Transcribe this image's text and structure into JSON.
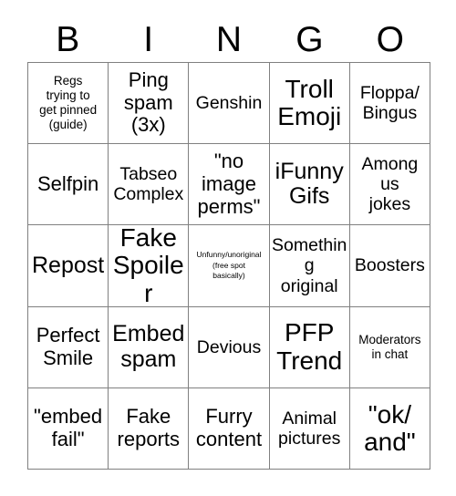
{
  "header": {
    "letters": [
      "B",
      "I",
      "N",
      "G",
      "O"
    ]
  },
  "grid": {
    "rows": 5,
    "columns": 5,
    "border_color": "#808080",
    "background_color": "#ffffff",
    "text_color": "#000000",
    "cells": [
      {
        "text": "Regs\ntrying to\nget pinned\n(guide)",
        "size": "xs",
        "free_space": false
      },
      {
        "text": "Ping\nspam\n(3x)",
        "size": "lg",
        "free_space": false
      },
      {
        "text": "Genshin",
        "size": "md",
        "free_space": false
      },
      {
        "text": "Troll\nEmoji",
        "size": "xxl",
        "free_space": false
      },
      {
        "text": "Floppa/\nBingus",
        "size": "md",
        "free_space": false
      },
      {
        "text": "Selfpin",
        "size": "lg",
        "free_space": false
      },
      {
        "text": "Tabseo\nComplex",
        "size": "md",
        "free_space": false
      },
      {
        "text": "\"no\nimage\nperms\"",
        "size": "lg",
        "free_space": false
      },
      {
        "text": "iFunny\nGifs",
        "size": "xl",
        "free_space": false
      },
      {
        "text": "Among\nus\njokes",
        "size": "md",
        "free_space": false
      },
      {
        "text": "Repost",
        "size": "xl",
        "free_space": false
      },
      {
        "text": "Fake\nSpoiler",
        "size": "xxl",
        "free_space": false
      },
      {
        "text": "Unfunny/unoriginal\n(free spot\nbasically)",
        "size": "xxs",
        "free_space": true
      },
      {
        "text": "Something\noriginal",
        "size": "md",
        "free_space": false
      },
      {
        "text": "Boosters",
        "size": "md",
        "free_space": false
      },
      {
        "text": "Perfect\nSmile",
        "size": "lg",
        "free_space": false
      },
      {
        "text": "Embed\nspam",
        "size": "xl",
        "free_space": false
      },
      {
        "text": "Devious",
        "size": "md",
        "free_space": false
      },
      {
        "text": "PFP\nTrend",
        "size": "xxl",
        "free_space": false
      },
      {
        "text": "Moderators\nin chat",
        "size": "xs",
        "free_space": false
      },
      {
        "text": "\"embed\nfail\"",
        "size": "lg",
        "free_space": false
      },
      {
        "text": "Fake\nreports",
        "size": "lg",
        "free_space": false
      },
      {
        "text": "Furry\ncontent",
        "size": "lg",
        "free_space": false
      },
      {
        "text": "Animal\npictures",
        "size": "md",
        "free_space": false
      },
      {
        "text": "\"ok/\nand\"",
        "size": "xxl",
        "free_space": false
      }
    ]
  }
}
